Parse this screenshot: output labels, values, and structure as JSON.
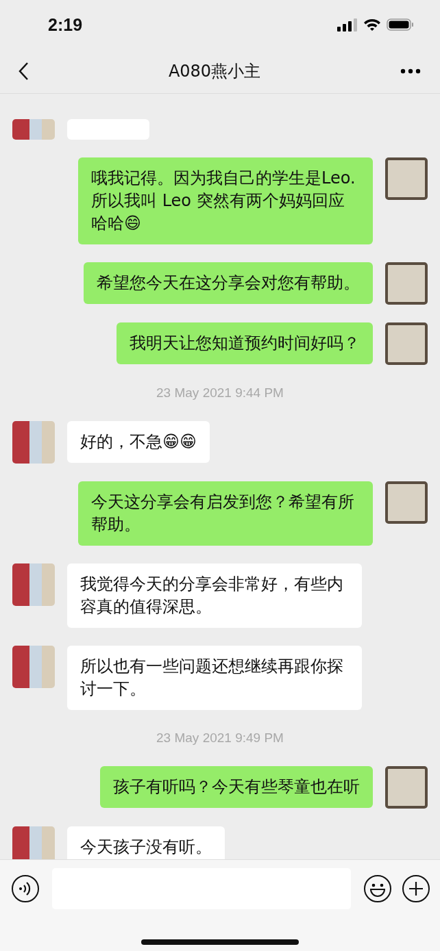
{
  "status_bar": {
    "time": "2:19"
  },
  "header": {
    "title": "A080燕小主"
  },
  "messages": [
    {
      "kind": "partial",
      "outgoing": false
    },
    {
      "kind": "text",
      "outgoing": true,
      "text": "哦我记得。因为我自己的学生是Leo. 所以我叫 Leo 突然有两个妈妈回应哈哈😄"
    },
    {
      "kind": "text",
      "outgoing": true,
      "text": "希望您今天在这分享会对您有帮助。"
    },
    {
      "kind": "text",
      "outgoing": true,
      "text": "我明天让您知道预约时间好吗？"
    },
    {
      "kind": "time",
      "text": "23 May 2021 9:44 PM"
    },
    {
      "kind": "text",
      "outgoing": false,
      "text": "好的，不急😁😁"
    },
    {
      "kind": "text",
      "outgoing": true,
      "text": "今天这分享会有启发到您？希望有所帮助。"
    },
    {
      "kind": "text",
      "outgoing": false,
      "text": "我觉得今天的分享会非常好，有些内容真的值得深思。"
    },
    {
      "kind": "text",
      "outgoing": false,
      "text": "所以也有一些问题还想继续再跟你探讨一下。"
    },
    {
      "kind": "time",
      "text": "23 May 2021 9:49 PM"
    },
    {
      "kind": "text",
      "outgoing": true,
      "text": "孩子有听吗？今天有些琴童也在听"
    },
    {
      "kind": "text",
      "outgoing": false,
      "text": "今天孩子没有听。"
    }
  ]
}
